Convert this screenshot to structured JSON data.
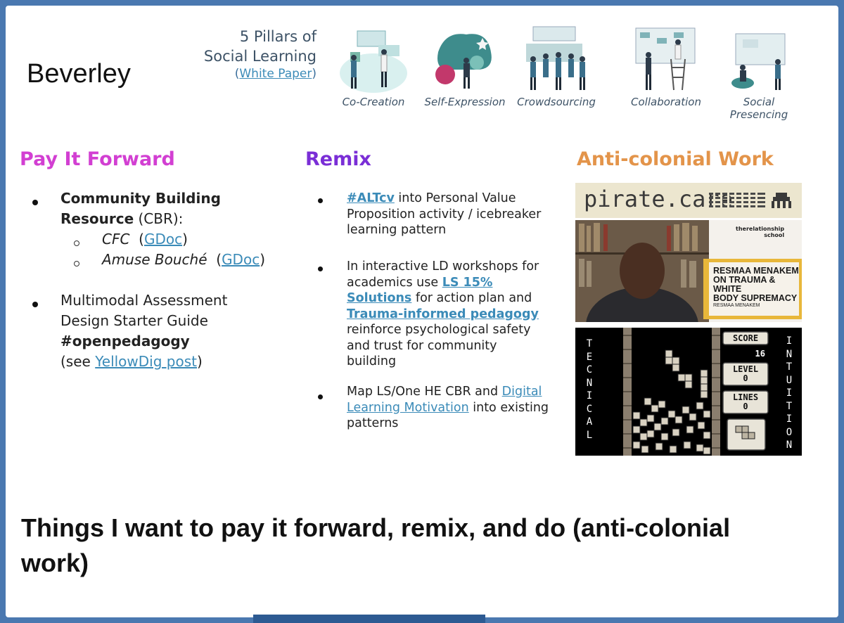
{
  "name": "Beverley",
  "pillars": {
    "title_line1": "5 Pillars of",
    "title_line2": "Social Learning",
    "link_open": "(",
    "link_text": "White Paper",
    "link_close": ")",
    "items": [
      {
        "label": "Co-Creation",
        "icon": "co-creation-illustration"
      },
      {
        "label": "Self-Expression",
        "icon": "self-expression-illustration"
      },
      {
        "label": "Crowdsourcing",
        "icon": "crowdsourcing-illustration"
      },
      {
        "label": "Collaboration",
        "icon": "collaboration-illustration"
      },
      {
        "label": "Social Presencing",
        "icon": "social-presencing-illustration"
      }
    ]
  },
  "columns": {
    "pay": {
      "heading": "Pay It Forward",
      "b1_bold1": "Community Building",
      "b1_bold2": "Resource",
      "b1_rest": " (CBR):",
      "s1_italic": "CFC",
      "s1_open": "  (",
      "s1_link": "GDoc",
      "s1_close": ")",
      "s2_italic": "Amuse Bouché",
      "s2_open": "  (",
      "s2_link": "GDoc",
      "s2_close": ")",
      "b2_line1": "Multimodal Assessment",
      "b2_line2": "Design Starter Guide",
      "b2_bold": "#openpedagogy",
      "b2_see": "(see ",
      "b2_link": "YellowDig post",
      "b2_close": ")"
    },
    "remix": {
      "heading": "Remix",
      "b1_link": "#ALTcv",
      "b1_rest1": " into Personal Value",
      "b1_line2": "Proposition activity / icebreaker",
      "b1_line3": "learning pattern",
      "b2_line1": "In interactive LD workshops for",
      "b2_line2a": "academics use ",
      "b2_link1a": "LS 15%",
      "b2_link1b": "Solutions",
      "b2_line3rest": " for action plan and",
      "b2_link2": "Trauma-informed pedagogy",
      "b2_line5": "reinforce psychological safety",
      "b2_line6": "and trust for community",
      "b2_line7": "building",
      "b3_line1a": "Map LS/One HE CBR and ",
      "b3_link1": "Digital",
      "b3_link2": "Learning Motivation",
      "b3_rest": " into existing",
      "b3_line3": "patterns"
    },
    "anti": {
      "heading": "Anti-colonial Work",
      "pirate_label": "pirate.care",
      "school_line1": "therelationship",
      "school_line2": "school",
      "book_line1": "RESMAA MENAKEM",
      "book_line2": "ON TRAUMA & WHITE",
      "book_line3": "BODY SUPREMACY",
      "book_line4": "RESMAA MENAKEM",
      "tetris_left": [
        "T",
        "E",
        "C",
        "N",
        "I",
        "C",
        "A",
        "L"
      ],
      "tetris_right": [
        "I",
        "N",
        "T",
        "U",
        "I",
        "T",
        "I",
        "O",
        "N"
      ],
      "score_label": "SCORE",
      "score_value": "16",
      "level_label": "LEVEL",
      "level_value": "0",
      "lines_label": "LINES",
      "lines_value": "0"
    }
  },
  "caption": "Things I want to pay it forward, remix, and do (anti-colonial work)",
  "colors": {
    "pay_heading": "#d23fd2",
    "remix_heading": "#7a2ed6",
    "anti_heading": "#e3944a",
    "link": "#3b8bb8",
    "frame": "#4a78b0"
  }
}
